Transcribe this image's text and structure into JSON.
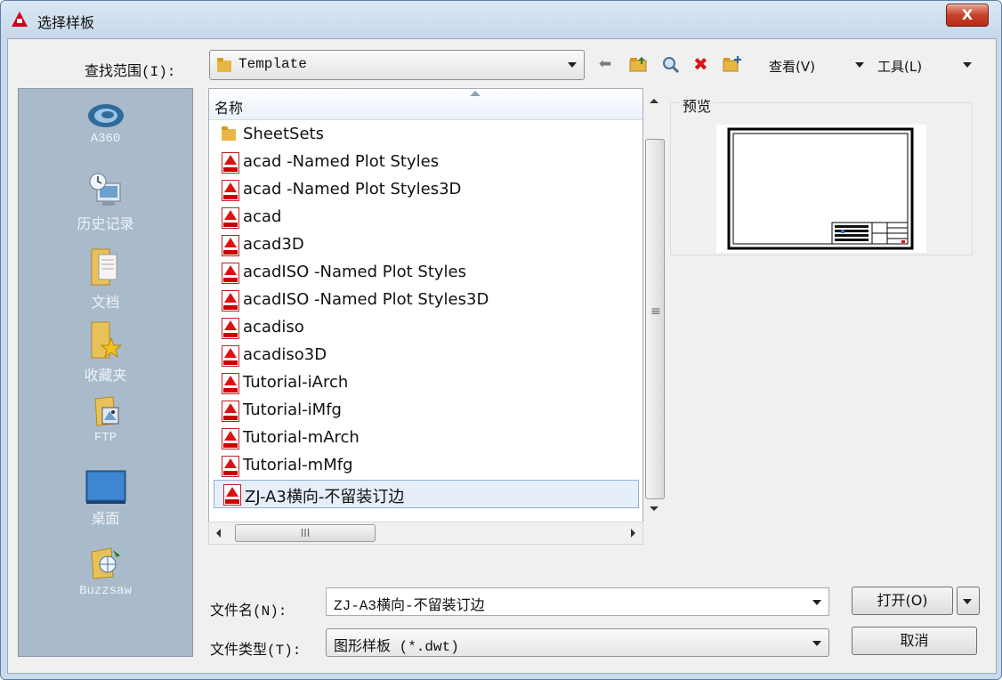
{
  "window": {
    "title": "选择样板",
    "close_label": "X"
  },
  "toolbar": {
    "look_in_label": "查找范围(I):",
    "look_in_value": "Template",
    "view_label": "查看(V)",
    "tools_label": "工具(L)"
  },
  "places": [
    {
      "label": "A360",
      "icon": "a360-icon"
    },
    {
      "label": "历史记录",
      "icon": "history-icon"
    },
    {
      "label": "文档",
      "icon": "documents-icon"
    },
    {
      "label": "收藏夹",
      "icon": "favorites-icon"
    },
    {
      "label": "FTP",
      "icon": "ftp-icon"
    },
    {
      "label": "桌面",
      "icon": "desktop-icon"
    },
    {
      "label": "Buzzsaw",
      "icon": "buzzsaw-icon"
    }
  ],
  "file_list": {
    "column_header": "名称",
    "items": [
      {
        "name": "SheetSets",
        "type": "folder"
      },
      {
        "name": "acad -Named Plot Styles",
        "type": "dwt"
      },
      {
        "name": "acad -Named Plot Styles3D",
        "type": "dwt"
      },
      {
        "name": "acad",
        "type": "dwt"
      },
      {
        "name": "acad3D",
        "type": "dwt"
      },
      {
        "name": "acadISO -Named Plot Styles",
        "type": "dwt"
      },
      {
        "name": "acadISO -Named Plot Styles3D",
        "type": "dwt"
      },
      {
        "name": "acadiso",
        "type": "dwt"
      },
      {
        "name": "acadiso3D",
        "type": "dwt"
      },
      {
        "name": "Tutorial-iArch",
        "type": "dwt"
      },
      {
        "name": "Tutorial-iMfg",
        "type": "dwt"
      },
      {
        "name": "Tutorial-mArch",
        "type": "dwt"
      },
      {
        "name": "Tutorial-mMfg",
        "type": "dwt"
      },
      {
        "name": "ZJ-A3横向-不留装订边",
        "type": "dwt",
        "selected": true
      }
    ],
    "hscroll_grip": "III"
  },
  "preview": {
    "label": "预览"
  },
  "bottom": {
    "filename_label": "文件名(N):",
    "filename_value": "ZJ-A3横向-不留装订边",
    "filetype_label": "文件类型(T):",
    "filetype_value": "图形样板 (*.dwt)",
    "open_label": "打开(O)",
    "cancel_label": "取消"
  },
  "colors": {
    "accent": "#d0021b",
    "places_bg": "#a9bacb",
    "titlebar": "#c9daea"
  }
}
